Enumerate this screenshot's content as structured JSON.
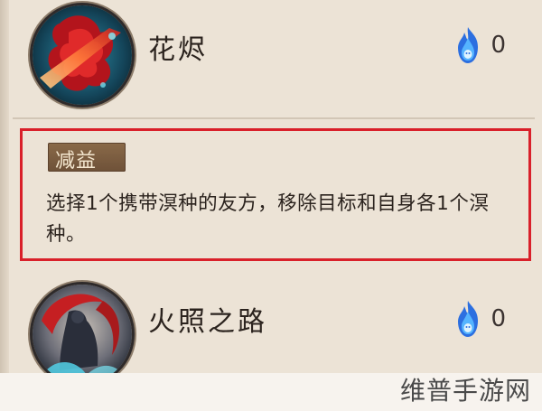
{
  "skills": [
    {
      "name": "花烬",
      "icon": "crimson-flower-slash-icon",
      "cost": {
        "icon": "blue-soulfire-icon",
        "value": "0"
      }
    },
    {
      "name": "火照之路",
      "icon": "cloaked-figure-crimson-moon-icon",
      "cost": {
        "icon": "blue-soulfire-icon",
        "value": "0"
      }
    }
  ],
  "description": {
    "tag": "减益",
    "text": "选择1个携带溟种的友方，移除目标和自身各1个溟种。"
  },
  "watermark": "维普手游网",
  "colors": {
    "background": "#ece3d6",
    "highlight_border": "#d9202a",
    "tag_background": "#7a5b40",
    "soulfire": "#3aa0f0"
  }
}
